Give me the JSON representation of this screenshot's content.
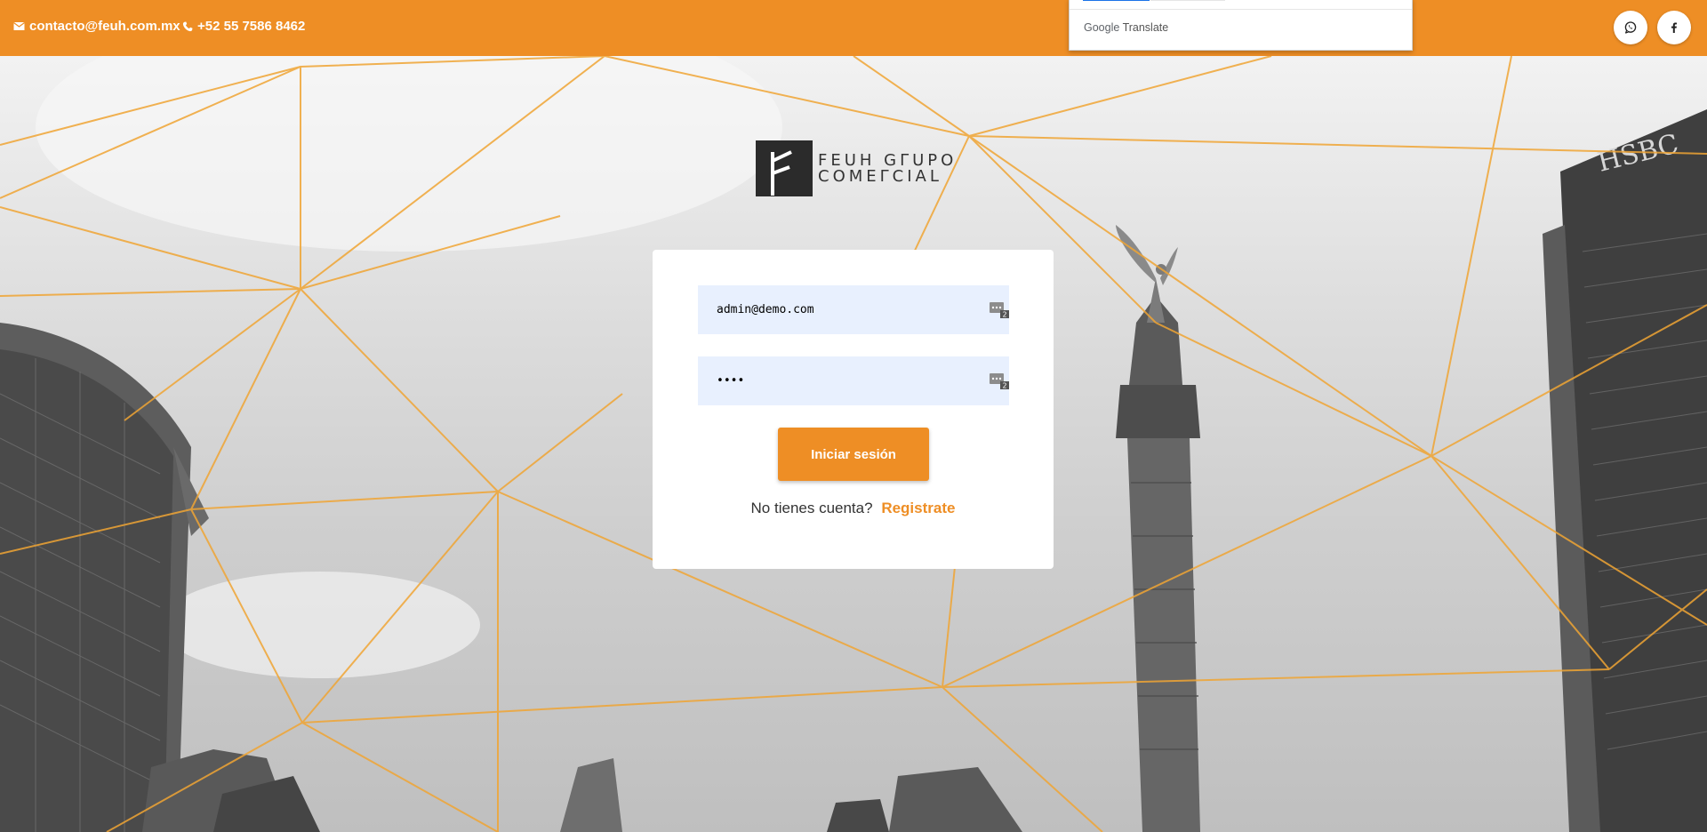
{
  "colors": {
    "accent": "#ee8e25",
    "field_bg": "#e8f0fe",
    "card_bg": "#ffffff",
    "translate_blue": "#1a73e8"
  },
  "topbar": {
    "email": "contacto@feuh.com.mx",
    "phone": "+52 55 7586 8462",
    "icons": [
      "envelope-icon",
      "phone-icon",
      "whatsapp-icon",
      "facebook-icon"
    ]
  },
  "translate": {
    "brand_google": "Google",
    "brand_translate": "Translate"
  },
  "logo": {
    "line1": "FEUH GΓUPO",
    "line2": "COMEΓCIAL"
  },
  "login": {
    "email_value": "admin@demo.com",
    "password_value": "••••",
    "password_manager_icon": "password-manager-icon",
    "password_manager_count": "2",
    "submit_label": "Iniciar sesión",
    "no_account_text": "No tienes cuenta?",
    "register_label": "Registrate"
  }
}
